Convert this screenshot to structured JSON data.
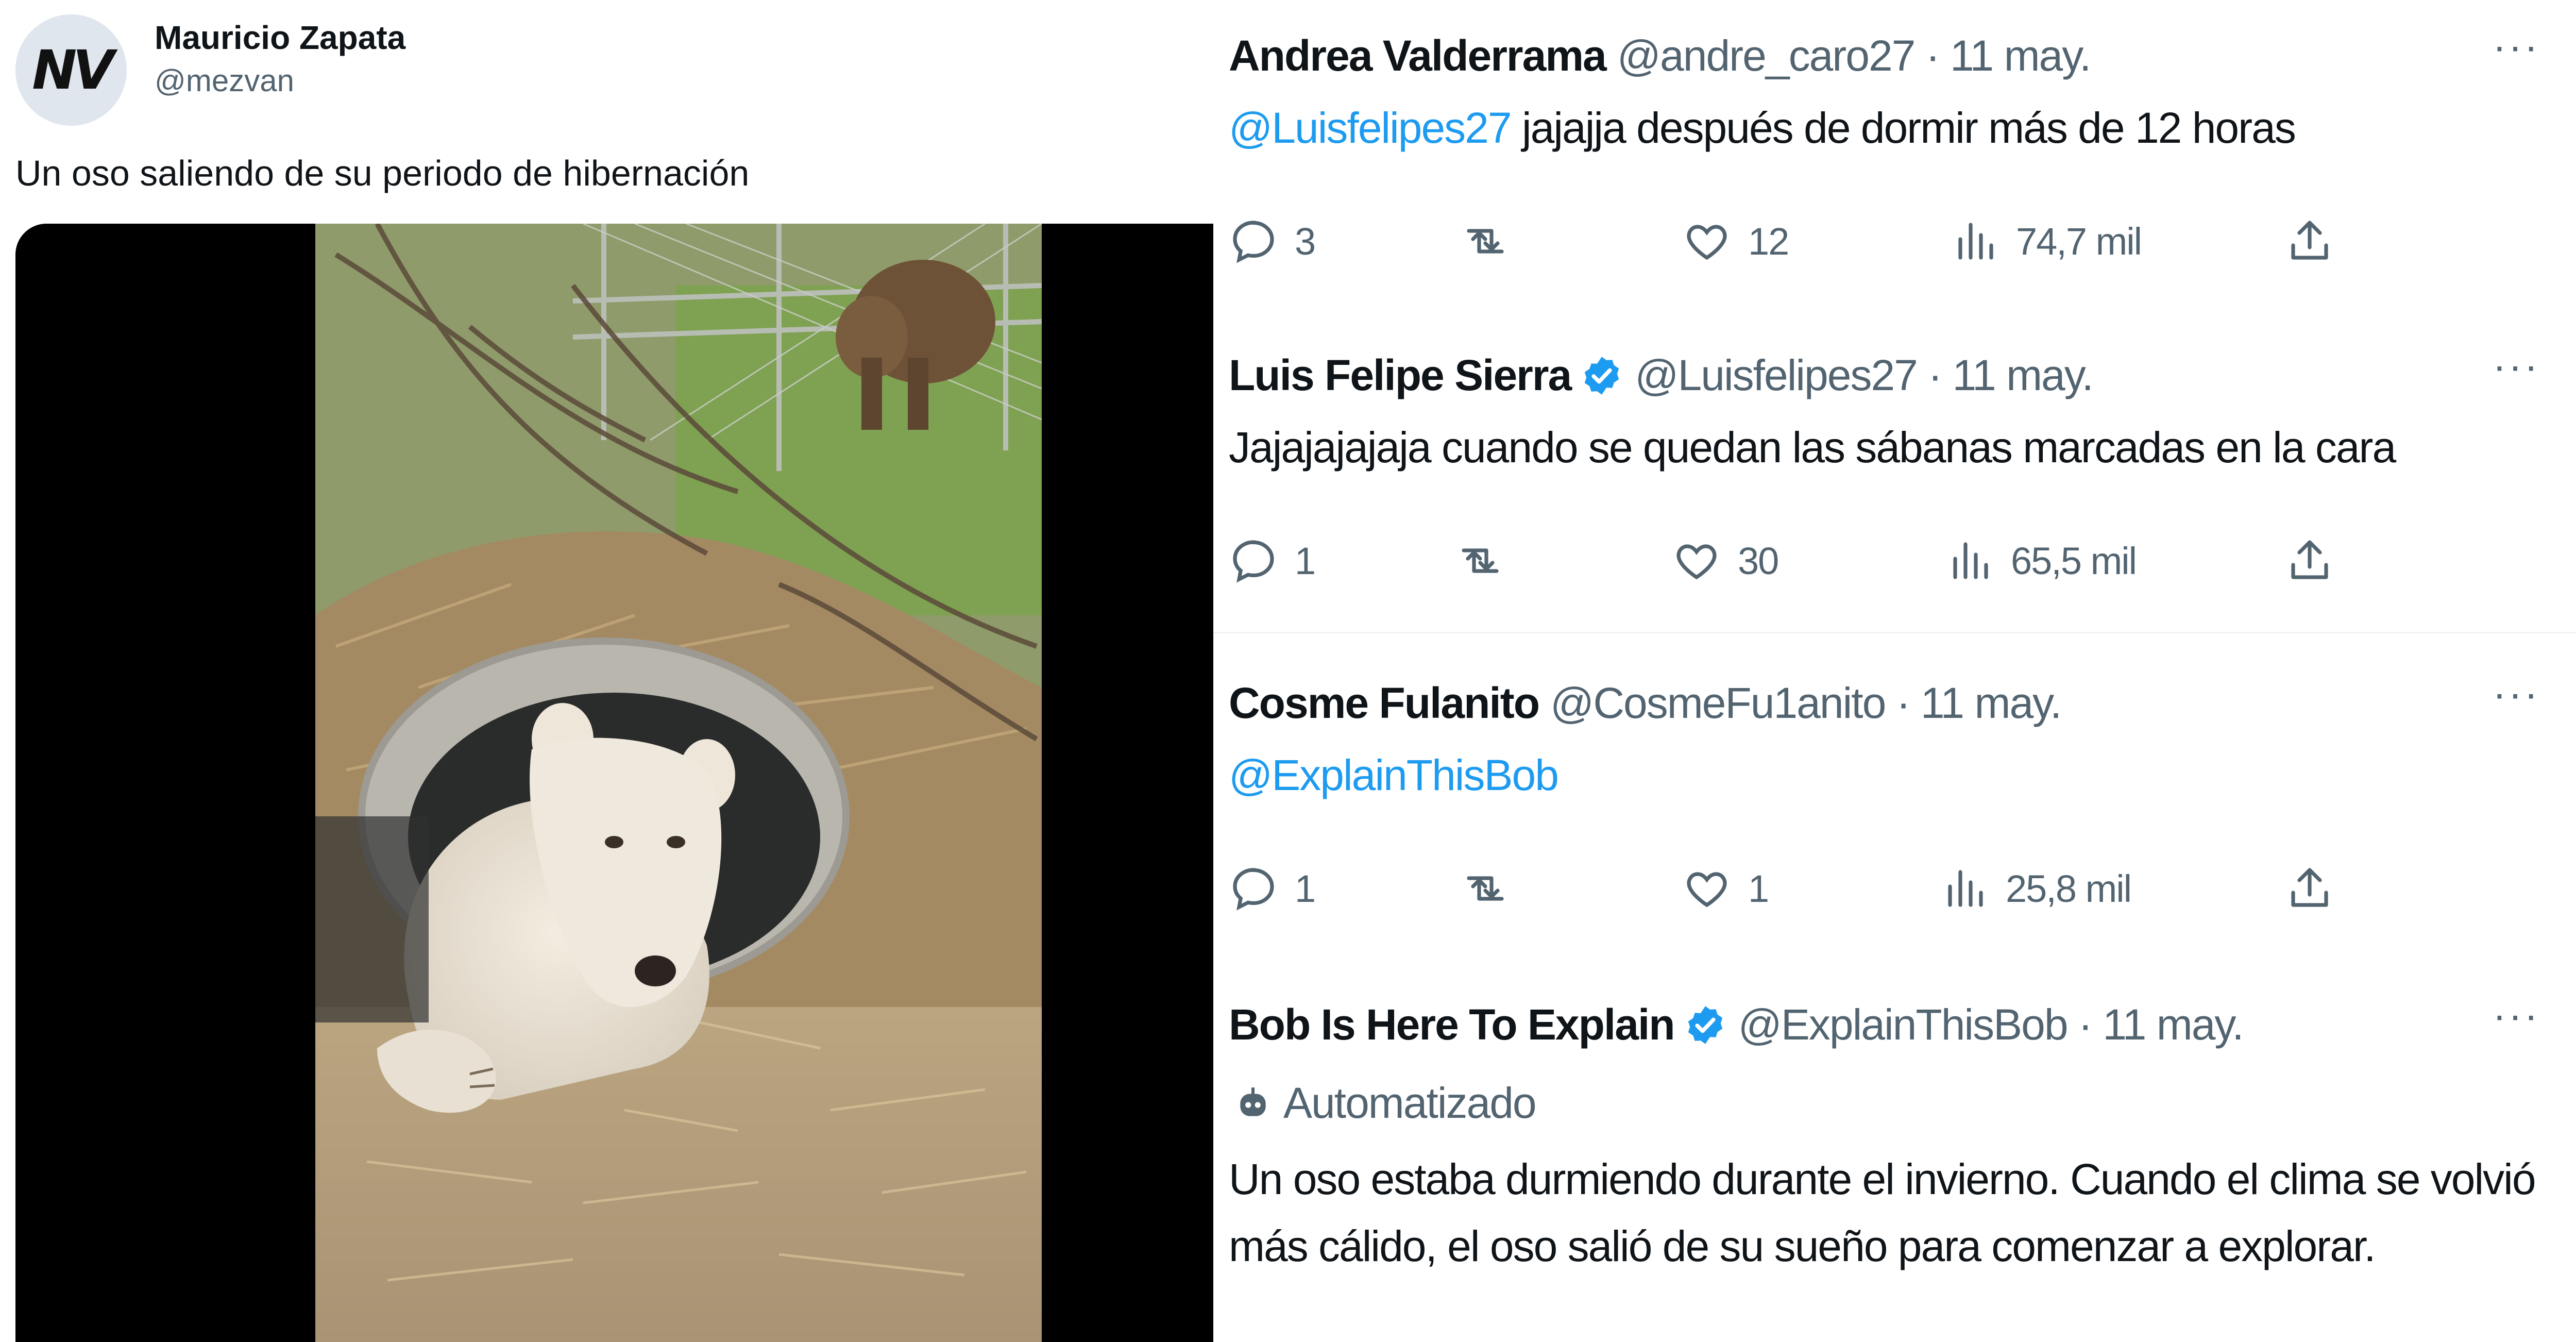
{
  "main_tweet": {
    "avatar_text": "NV",
    "author_name": "Mauricio Zapata",
    "author_handle": "@mezvan",
    "text": "Un oso saliendo de su periodo de hibernación"
  },
  "replies": [
    {
      "name": "Andrea Valderrama",
      "verified": false,
      "meta": "@andre_caro27 · 11 may.",
      "mention": "@Luisfelipes27",
      "text": " jajajja después de dormir más de 12 horas",
      "stats": {
        "replies": "3",
        "retweets": "",
        "likes": "12",
        "views": "74,7 mil"
      }
    },
    {
      "name": "Luis Felipe Sierra",
      "verified": true,
      "meta": "@Luisfelipes27 · 11 may.",
      "mention": "",
      "text": "Jajajajajaja cuando se quedan las sábanas marcadas en la cara",
      "stats": {
        "replies": "1",
        "retweets": "",
        "likes": "30",
        "views": "65,5 mil"
      }
    },
    {
      "name": "Cosme Fulanito",
      "verified": false,
      "meta": "@CosmeFu1anito · 11 may.",
      "mention": "@ExplainThisBob",
      "text": "",
      "stats": {
        "replies": "1",
        "retweets": "",
        "likes": "1",
        "views": "25,8 mil"
      }
    },
    {
      "name": "Bob Is Here To Explain",
      "verified": true,
      "meta": "@ExplainThisBob · 11 may.",
      "bot_label": "Automatizado",
      "text_line1": "Un oso estaba durmiendo durante el invierno. Cuando el clima se volvió",
      "text_line2": "más cálido, el oso salió de su sueño para comenzar a explorar."
    }
  ],
  "more_label": "···",
  "colors": {
    "accent": "#1d9bf0",
    "muted": "#536471",
    "text": "#0f1419"
  }
}
